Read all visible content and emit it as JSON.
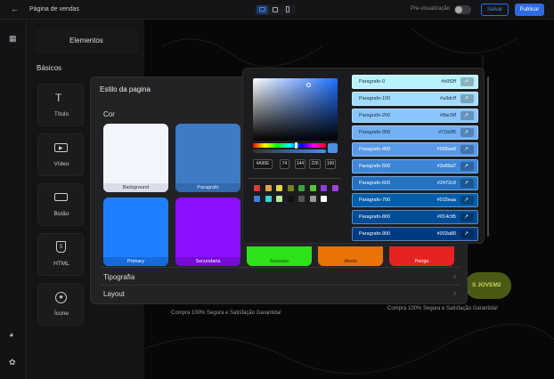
{
  "topbar": {
    "back_icon": "arrow-left-icon",
    "title": "Página de vendas",
    "preview_label": "Pré-visualização",
    "save_label": "Salvar",
    "publish_label": "Publicar",
    "colors": {
      "accent": "#2d6be4"
    }
  },
  "sidebar": {
    "header": "Elementos",
    "section": "Básicos",
    "items": [
      {
        "label": "Título",
        "icon": "text-icon"
      },
      {
        "label": "Vídeo",
        "icon": "video-icon"
      },
      {
        "label": "Botão",
        "icon": "button-icon"
      },
      {
        "label": "HTML",
        "icon": "html-icon"
      },
      {
        "label": "Ícone",
        "icon": "star-icon"
      }
    ]
  },
  "canvas": {
    "guarantee_left": "Compra 100% Segura e Satisfação Garantida!",
    "guarantee_right": "Compra 100% Segura e Satisfação Garantida!",
    "cta_partial": "S JOVEM2"
  },
  "page_style": {
    "title": "Estilo da pagina",
    "section_color": "Cor",
    "swatches": [
      {
        "label": "Background",
        "color": "#f2f5fc"
      },
      {
        "label": "Paragrafo",
        "color": "#3d7bc4"
      },
      {
        "label": "Primary",
        "color": "#1f80ff"
      },
      {
        "label": "Secundaria",
        "color": "#8c0fff"
      },
      {
        "label": "Sucesso",
        "color": "#2ee21a"
      },
      {
        "label": "Alerta",
        "color": "#e97307"
      },
      {
        "label": "Perigo",
        "color": "#e52320"
      }
    ],
    "section_typography": "Tipografia",
    "section_layout": "Layout"
  },
  "color_picker": {
    "hex": "4A90E",
    "r": "74",
    "g": "144",
    "b": "226",
    "a": "100",
    "preset_row1": [
      "#d83a3a",
      "#e4a24a",
      "#e8d24a",
      "#7a7f2a",
      "#3ba33a",
      "#56c23a",
      "#8a3fe0",
      "#a43fe0"
    ],
    "preset_row2": [
      "#3f7fe0",
      "#3fd0d0",
      "#b7e89a",
      "#111111",
      "#555555",
      "#9a9a9a",
      "#ffffff"
    ]
  },
  "shades": [
    {
      "name": "Paragrafo-0",
      "hex": "#b9f2ff",
      "bg": "#b9f2ff",
      "fg": "#1a2b3a"
    },
    {
      "name": "Paragrafo-100",
      "hex": "#a3dcff",
      "bg": "#a3dcff",
      "fg": "#1a2b3a"
    },
    {
      "name": "Paragrafo-200",
      "hex": "#8ac5ff",
      "bg": "#8ac5ff",
      "fg": "#1a2b3a"
    },
    {
      "name": "Paragrafo-300",
      "hex": "#71b0f5",
      "bg": "#71b0f5",
      "fg": "#1a2b3a"
    },
    {
      "name": "Paragrafo-400",
      "hex": "#589ae8",
      "bg": "#589ae8",
      "fg": "#ffffff"
    },
    {
      "name": "Paragrafo-500",
      "hex": "#3e86d7",
      "bg": "#3e86d7",
      "fg": "#ffffff"
    },
    {
      "name": "Paragrafo-600",
      "hex": "#2472c0",
      "bg": "#2472c0",
      "fg": "#ffffff"
    },
    {
      "name": "Paragrafo-700",
      "hex": "#015eaa",
      "bg": "#015eaa",
      "fg": "#ffffff"
    },
    {
      "name": "Paragrafo-800",
      "hex": "#014c95",
      "bg": "#014c95",
      "fg": "#ffffff"
    },
    {
      "name": "Paragrafo-900",
      "hex": "#003a80",
      "bg": "#003a80",
      "fg": "#ffffff"
    }
  ]
}
